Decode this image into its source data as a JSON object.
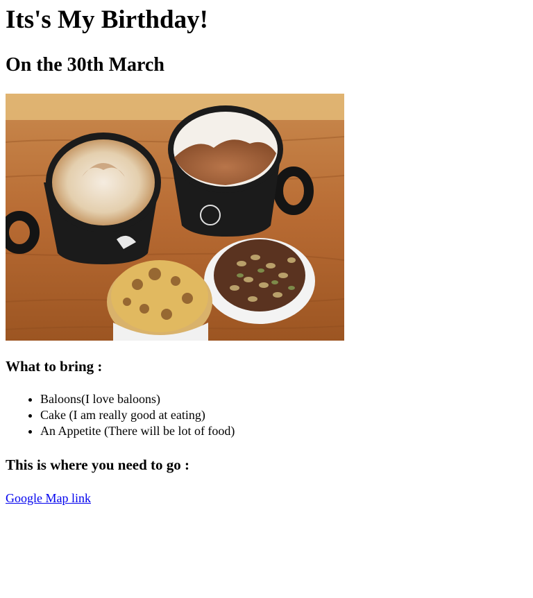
{
  "title": "Its's My Birthday!",
  "subtitle": "On the 30th March",
  "photo_subject": "coffee-mugs-and-muffins",
  "bring": {
    "heading": "What to bring :",
    "items": [
      "Baloons(I love baloons)",
      "Cake (I am really good at eating)",
      "An Appetite (There will be lot of food)"
    ]
  },
  "location": {
    "heading": "This is where you need to go :",
    "link_label": "Google Map link"
  }
}
